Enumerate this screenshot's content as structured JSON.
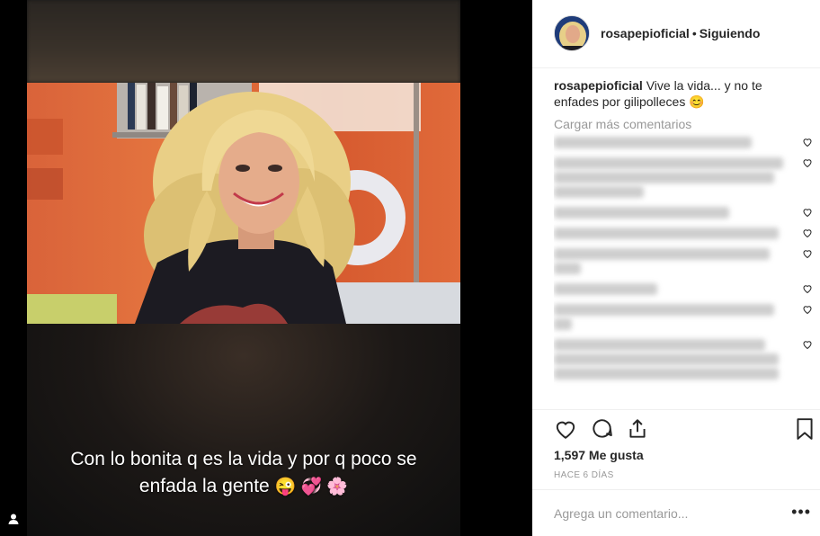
{
  "post": {
    "caption_line1": "Con lo bonita q es la vida y por q poco se",
    "caption_line2": "enfada la gente",
    "caption_emojis": "😜 💞 🌸"
  },
  "header": {
    "username": "rosapepioficial",
    "separator": "•",
    "follow_status": "Siguiendo"
  },
  "owner_comment": {
    "username": "rosapepioficial",
    "text": "Vive la vida... y no te enfades por gilipolleces 😊"
  },
  "load_more_label": "Cargar más comentarios",
  "actions": {
    "likes": "1,597 Me gusta",
    "timestamp": "HACE 6 DÍAS"
  },
  "add_comment": {
    "placeholder": "Agrega un comentario...",
    "more_label": "•••"
  },
  "colors": {
    "text": "#262626",
    "muted": "#999999",
    "border": "#efefef"
  }
}
